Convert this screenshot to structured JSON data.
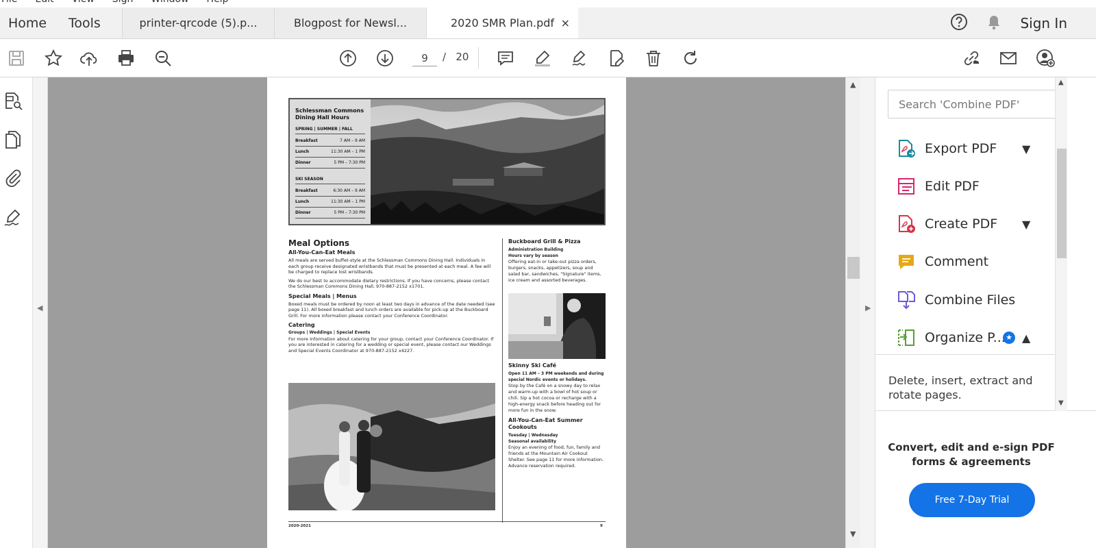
{
  "menu": [
    "File",
    "Edit",
    "View",
    "Sign",
    "Window",
    "Help"
  ],
  "nav": {
    "home": "Home",
    "tools": "Tools"
  },
  "tabs": [
    {
      "label": "printer-qrcode (5).p..."
    },
    {
      "label": "Blogpost for Newsl..."
    },
    {
      "label": "2020 SMR Plan.pdf",
      "close": "×"
    }
  ],
  "header": {
    "sign_in": "Sign In",
    "help_icon": "help-circle-icon",
    "bell_icon": "bell-icon"
  },
  "toolbar": {
    "current_page": "9",
    "page_sep": "/",
    "total_pages": "20",
    "icons": [
      "save-icon",
      "star-icon",
      "cloud-upload-icon",
      "print-icon",
      "zoom-icon",
      "page-up-icon",
      "page-down-icon",
      "comment-icon",
      "highlight-icon",
      "sign-icon",
      "fill-edit-icon",
      "trash-icon",
      "rotate-icon",
      "share-link-icon",
      "email-icon",
      "add-user-icon"
    ]
  },
  "document": {
    "hours_title": "Schlessman Commons Dining Hall Hours",
    "season1": "SPRING | SUMMER | FALL",
    "season1_rows": [
      {
        "meal": "Breakfast",
        "time": "7 AM – 9 AM"
      },
      {
        "meal": "Lunch",
        "time": "11:30 AM – 1 PM"
      },
      {
        "meal": "Dinner",
        "time": "5 PM – 7:30 PM"
      }
    ],
    "season2": "SKI SEASON",
    "season2_rows": [
      {
        "meal": "Breakfast",
        "time": "6:30 AM – 9 AM"
      },
      {
        "meal": "Lunch",
        "time": "11:30 AM – 1 PM"
      },
      {
        "meal": "Dinner",
        "time": "5 PM – 7:30 PM"
      }
    ],
    "meal_options": "Meal Options",
    "ayce_title": "All-You-Can-Eat Meals",
    "ayce_p1": "All meals are served buffet-style at the Schlessman Commons Dining Hall. Individuals in each group receive designated wristbands that must be presented at each meal. A fee will be charged to replace lost wristbands.",
    "ayce_p2": "We do our best to accommodate dietary restrictions. If you have concerns, please contact the Schlessman Commons Dining Hall, 970-887-2152 x1701.",
    "special_title": "Special Meals | Menus",
    "special_p": "Boxed meals must be ordered by noon at least two days in advance of the date needed (see page 11). All boxed breakfast and lunch orders are available for pick-up at the Buckboard Grill. For more information please contact your Conference Coordinator.",
    "catering_title": "Catering",
    "catering_sub": "Groups | Weddings | Special Events",
    "catering_p": "For more information about catering for your group, contact your Conference Coordinator. If you are interested in catering for a wedding or special event, please contact our Weddings and Special Events Coordinator at 970-887-2152 x4227.",
    "buckboard_title": "Buckboard Grill & Pizza",
    "buckboard_sub1": "Administration Building",
    "buckboard_sub2": "Hours vary by season",
    "buckboard_p": "Offering eat-in or take-out pizza orders, burgers, snacks, appetizers, soup and salad bar, sandwiches, \"Signature\" items, ice cream and assorted beverages.",
    "skinny_title": "Skinny Ski Café",
    "skinny_sub": "Open 11 AM – 3 PM weekends and during special Nordic events or holidays.",
    "skinny_p": "Stop by the Café on a snowy day to relax and warm-up with a bowl of hot soup or chili. Sip a hot cocoa or recharge with a high-energy snack before heading out for more fun in the snow.",
    "cookout_title": "All-You-Can-Eat Summer Cookouts",
    "cookout_sub1": "Tuesday | Wednesday",
    "cookout_sub2": "Seasonal availability",
    "cookout_p": "Enjoy an evening of food, fun, family and friends at the Mountain Air Cookout Shelter. See page 11 for more information. Advance reservation required.",
    "footer_left": "2020-2021",
    "footer_right": "9"
  },
  "panel": {
    "search_placeholder": "Search 'Combine PDF'",
    "tools": [
      {
        "label": "Export PDF",
        "icon": "export-pdf-icon",
        "color": "#1a8a9c"
      },
      {
        "label": "Edit PDF",
        "icon": "edit-pdf-icon",
        "color": "#d6276a"
      },
      {
        "label": "Create PDF",
        "icon": "create-pdf-icon",
        "color": "#d9334a"
      },
      {
        "label": "Comment",
        "icon": "comment-icon",
        "color": "#e6a817"
      },
      {
        "label": "Combine Files",
        "icon": "combine-files-icon",
        "color": "#6b5bd6"
      },
      {
        "label": "Organize P...",
        "icon": "organize-pages-icon",
        "color": "#5a9e35"
      }
    ],
    "description": "Delete, insert, extract and rotate pages.",
    "promo": "Convert, edit and e-sign PDF forms & agreements",
    "trial_button": "Free 7-Day Trial",
    "accent": "#1473e6"
  }
}
